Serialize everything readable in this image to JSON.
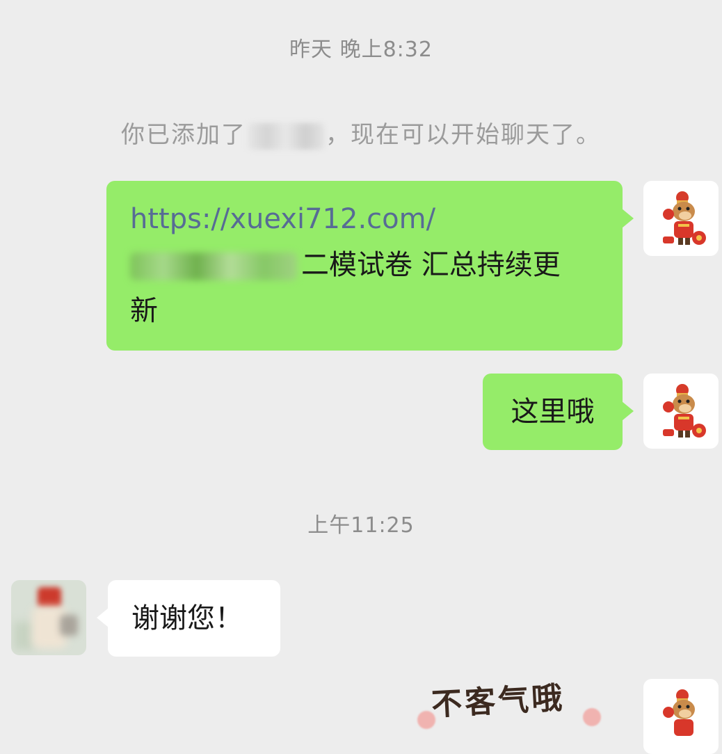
{
  "chat": {
    "timestamp_1": "昨天 晚上8:32",
    "system_prefix": "你已添加了",
    "system_suffix": "，现在可以开始聊天了。",
    "msg1_link": "https://xuexi712.com/",
    "msg1_text_line2": "二模试卷 汇总持续更",
    "msg1_text_line3": "新",
    "msg2": "这里哦",
    "timestamp_2": "上午11:25",
    "msg3": "谢谢您！",
    "sticker_text": "不客气哦"
  },
  "colors": {
    "background": "#ededed",
    "sent_bubble": "#95ec69",
    "received_bubble": "#ffffff",
    "link": "#576b95"
  },
  "icons": {
    "own_avatar": "cartoon-bull-avatar-icon",
    "contact_avatar": "blurred-contact-avatar"
  }
}
